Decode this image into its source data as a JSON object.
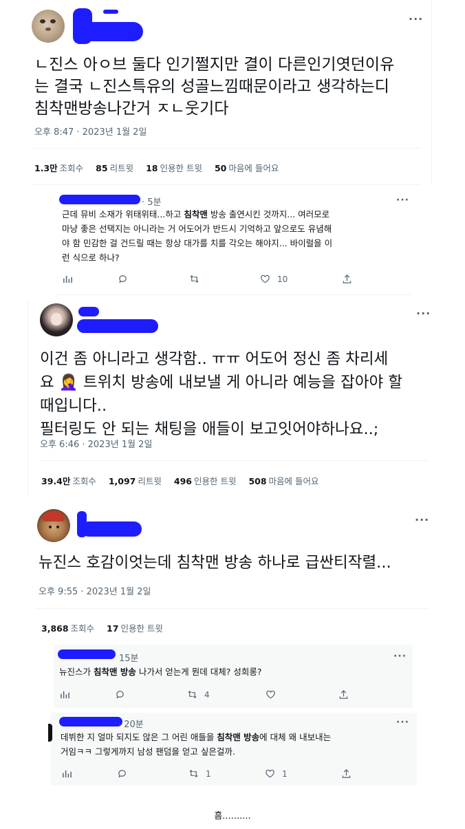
{
  "tweet1": {
    "text_lines": [
      "ㄴ진스 아ㅇ브 둘다 인기쩔지만 결이 다른인기엿던이유",
      "는 결국 ㄴ진스특유의 성골느낌때문이라고 생각하는디",
      "침착맨방송나간거 ㅈㄴ웃기다"
    ],
    "timestamp": "오후 8:47 · 2023년 1월 2일",
    "stats": [
      {
        "value": "1.3만",
        "label": "조회수"
      },
      {
        "value": "85",
        "label": "리트윗"
      },
      {
        "value": "18",
        "label": "인용한 트윗"
      },
      {
        "value": "50",
        "label": "마음에 들어요"
      }
    ],
    "more": "···"
  },
  "reply1": {
    "time": "· 5분",
    "text_parts": [
      "근데 뮤비 소재가 위태위태...하고 ",
      "침착맨",
      " 방송 출연시킨 것까지... 여러모로",
      "마냥 좋은 선택지는 아니라는 거 어도어가 반드시 기억하고 앞으로도 유념해",
      "야 함 민감한 걸 건드릴 때는 항상 대가를 치를 각오는 해야지... 바이럴을 이",
      "런 식으로 하나?"
    ],
    "like_count": "10",
    "more": "···"
  },
  "tweet2": {
    "text_lines": [
      "이건 좀 아니라고 생각함.. ㅠㅠ 어도어 정신 좀 차리세",
      "요 🤦‍♀️ 트위치 방송에 내보낼 게 아니라 예능을 잡아야 할",
      "때입니다..",
      "필터링도 안 되는 채팅을 애들이 보고잇어야하나요..;"
    ],
    "timestamp": "오후 6:46 · 2023년 1월 2일",
    "stats": [
      {
        "value": "39.4만",
        "label": "조회수"
      },
      {
        "value": "1,097",
        "label": "리트윗"
      },
      {
        "value": "496",
        "label": "인용한 트윗"
      },
      {
        "value": "508",
        "label": "마음에 들어요"
      }
    ],
    "more": "···"
  },
  "tweet3": {
    "text_lines": [
      "뉴진스 호감이엇는데 침착맨 방송 하나로 급싼티작렬..."
    ],
    "timestamp": "오후 9:55 · 2023년 1월 2일",
    "stats": [
      {
        "value": "3,868",
        "label": "조회수"
      },
      {
        "value": "17",
        "label": "인용한 트윗"
      }
    ],
    "more": "···"
  },
  "reply2": {
    "time": "15분",
    "text_parts": [
      "뉴진스가 ",
      "침착맨 방송",
      " 나가서 얻는게 뭔데 대체? 성희롱?"
    ],
    "retweet_count": "4",
    "more": "···"
  },
  "reply3": {
    "time": "· 20분",
    "text_parts": [
      "데뷔한 지 얼마 되지도 않은 그 어린 애들을 ",
      "침착맨 방송",
      "에 대체 왜 내보내는",
      "거임ㅋㅋ 그렇게까지 남성 팬덤을 얻고 싶은걸까."
    ],
    "retweet_count": "1",
    "like_count": "1",
    "more": "···"
  },
  "footer": {
    "text": "흠.........."
  }
}
